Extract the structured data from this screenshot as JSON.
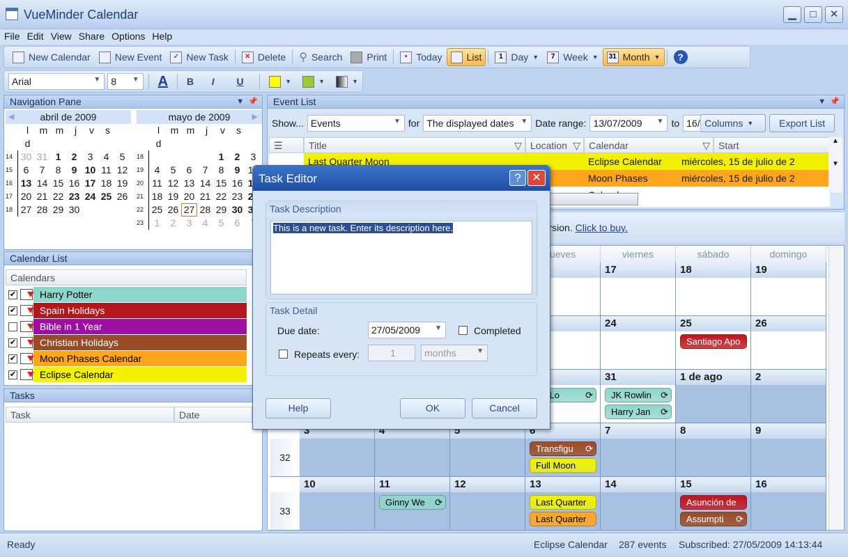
{
  "window": {
    "title": "VueMinder Calendar",
    "min": "▁",
    "max": "□",
    "close": "✕"
  },
  "menu": [
    "File",
    "Edit",
    "View",
    "Share",
    "Options",
    "Help"
  ],
  "toolbar": {
    "new_calendar": "New Calendar",
    "new_event": "New Event",
    "new_task": "New Task",
    "delete": "Delete",
    "search": "Search",
    "print": "Print",
    "today": "Today",
    "list": "List",
    "day": "Day",
    "week": "Week",
    "month": "Month",
    "day_icon": "1",
    "week_icon": "7",
    "month_icon": "31",
    "help": "?"
  },
  "format_bar": {
    "font": "Arial",
    "size": "8",
    "font_color": "A",
    "bold": "B",
    "italic": "I",
    "underline": "U",
    "colors": [
      "#ffff00",
      "#99cc33",
      "#333333"
    ]
  },
  "nav_pane": {
    "title": "Navigation Pane",
    "months": [
      {
        "name": "abril de 2009",
        "weeks": [
          {
            "n": "14",
            "d": [
              "30",
              "31",
              "1",
              "2",
              "3",
              "4",
              "5"
            ],
            "b": [
              2,
              3
            ],
            "g": [
              0,
              1
            ]
          },
          {
            "n": "15",
            "d": [
              "6",
              "7",
              "8",
              "9",
              "10",
              "11",
              "12"
            ],
            "b": [
              3,
              4
            ]
          },
          {
            "n": "16",
            "d": [
              "13",
              "14",
              "15",
              "16",
              "17",
              "18",
              "19"
            ],
            "b": [
              0,
              4
            ]
          },
          {
            "n": "17",
            "d": [
              "20",
              "21",
              "22",
              "23",
              "24",
              "25",
              "26"
            ],
            "b": [
              3,
              4,
              5
            ]
          },
          {
            "n": "18",
            "d": [
              "27",
              "28",
              "29",
              "30",
              "",
              "",
              ""
            ]
          }
        ]
      },
      {
        "name": "mayo de 2009",
        "weeks": [
          {
            "n": "18",
            "d": [
              "",
              "",
              "",
              "",
              "1",
              "2",
              "3"
            ],
            "b": [
              4,
              5
            ]
          },
          {
            "n": "19",
            "d": [
              "4",
              "5",
              "6",
              "7",
              "8",
              "9",
              "10"
            ],
            "b": [
              5
            ]
          },
          {
            "n": "20",
            "d": [
              "11",
              "12",
              "13",
              "14",
              "15",
              "16",
              "17"
            ],
            "b": [
              6
            ]
          },
          {
            "n": "21",
            "d": [
              "18",
              "19",
              "20",
              "21",
              "22",
              "23",
              "24"
            ],
            "b": [
              6
            ]
          },
          {
            "n": "22",
            "d": [
              "25",
              "26",
              "27",
              "28",
              "29",
              "30",
              "31"
            ],
            "b": [
              5,
              6
            ],
            "today": 2
          },
          {
            "n": "23",
            "d": [
              "1",
              "2",
              "3",
              "4",
              "5",
              "6",
              "7"
            ],
            "g": [
              0,
              1,
              2,
              3,
              4,
              5,
              6
            ]
          }
        ]
      }
    ],
    "weekdays": [
      "l",
      "m",
      "m",
      "j",
      "v",
      "s",
      "d"
    ]
  },
  "calendar_list": {
    "title": "Calendar List",
    "column": "Calendars",
    "items": [
      {
        "name": "Harry Potter",
        "checked": true,
        "color": "#8fd6cc",
        "text": "#000"
      },
      {
        "name": "Spain Holidays",
        "checked": true,
        "color": "#b3161b",
        "text": "#fff"
      },
      {
        "name": "Bible in 1 Year",
        "checked": false,
        "color": "#9b0fa3",
        "text": "#fff"
      },
      {
        "name": "Christian Holidays",
        "checked": true,
        "color": "#9a4a24",
        "text": "#fff"
      },
      {
        "name": "Moon Phases Calendar",
        "checked": true,
        "color": "#ffa51e",
        "text": "#000"
      },
      {
        "name": "Eclipse Calendar",
        "checked": true,
        "color": "#f2f200",
        "text": "#000"
      }
    ]
  },
  "tasks": {
    "title": "Tasks",
    "columns": [
      "Task",
      "Date"
    ]
  },
  "event_list": {
    "title": "Event List",
    "show_label": "Show...",
    "show_value": "Events",
    "for_label": "for",
    "for_value": "The displayed dates",
    "range_label": "Date range:",
    "range_from": "13/07/2009",
    "to_label": "to",
    "range_to": "16/",
    "columns_btn": "Columns",
    "export_btn": "Export List",
    "headers": [
      "Title",
      "Location",
      "Calendar",
      "Start"
    ],
    "rows": [
      {
        "title": "Last Quarter Moon",
        "calendar": "Eclipse Calendar",
        "start": "miércoles, 15 de julio de 2",
        "color": "#f0f000"
      },
      {
        "title": "",
        "calendar": "Moon Phases Calendar",
        "start": "miércoles, 15 de julio de 2",
        "color": "#ffa51e"
      }
    ]
  },
  "trial": {
    "text": "This is atrial version.",
    "link": "Click to buy."
  },
  "month_view": {
    "weekdays": [
      "",
      "",
      "",
      "ueves",
      "viernes",
      "sábado",
      "domingo"
    ],
    "weeks": [
      {
        "n": "",
        "days": [
          "",
          "",
          "",
          "",
          "17",
          "18",
          "19"
        ],
        "shade": []
      },
      {
        "n": "",
        "days": [
          "",
          "",
          "",
          "",
          "24",
          "25",
          "26"
        ],
        "shade": []
      },
      {
        "n": "",
        "days": [
          "",
          "",
          "",
          "",
          "31",
          "1 de ago",
          "2"
        ],
        "shade": [
          5,
          6
        ]
      },
      {
        "n": "32",
        "days": [
          "3",
          "4",
          "5",
          "6",
          "7",
          "8",
          "9"
        ],
        "shade": [
          0,
          1,
          2,
          3,
          4,
          5,
          6
        ]
      },
      {
        "n": "33",
        "days": [
          "10",
          "11",
          "12",
          "13",
          "14",
          "15",
          "16"
        ],
        "shade": [
          0,
          1,
          2,
          3,
          4,
          5,
          6
        ]
      }
    ],
    "events": [
      {
        "week": 1,
        "day": 5,
        "slot": 0,
        "title": "Santiago Apo",
        "color": "#c0141c",
        "text": "#fff"
      },
      {
        "week": 2,
        "day": 3,
        "slot": 0,
        "title": "ille Lo",
        "color": "#8fd6cc",
        "text": "#000",
        "recurring": true
      },
      {
        "week": 2,
        "day": 4,
        "slot": 0,
        "title": "JK Rowlin",
        "color": "#8fd6cc",
        "text": "#000",
        "recurring": true
      },
      {
        "week": 2,
        "day": 4,
        "slot": 1,
        "title": "Harry Jan",
        "color": "#8fd6cc",
        "text": "#000",
        "recurring": true
      },
      {
        "week": 3,
        "day": 3,
        "slot": 0,
        "title": "Transfigu",
        "color": "#9a4a24",
        "text": "#fff",
        "recurring": true
      },
      {
        "week": 3,
        "day": 3,
        "slot": 1,
        "title": "Full Moon",
        "color": "#f2f200",
        "text": "#000"
      },
      {
        "week": 4,
        "day": 1,
        "slot": 0,
        "title": "Ginny We",
        "color": "#8fd6cc",
        "text": "#000",
        "recurring": true
      },
      {
        "week": 4,
        "day": 3,
        "slot": 0,
        "title": "Last Quarter",
        "color": "#f2f200",
        "text": "#000"
      },
      {
        "week": 4,
        "day": 3,
        "slot": 1,
        "title": "Last Quarter",
        "color": "#ffa51e",
        "text": "#000"
      },
      {
        "week": 4,
        "day": 5,
        "slot": 0,
        "title": "Asunción de",
        "color": "#c0141c",
        "text": "#fff"
      },
      {
        "week": 4,
        "day": 5,
        "slot": 1,
        "title": "Assumpti",
        "color": "#9a4a24",
        "text": "#fff",
        "recurring": true
      }
    ]
  },
  "dialog": {
    "title": "Task Editor",
    "help_icon": "?",
    "close_icon": "✕",
    "desc_section": "Task Description",
    "desc_text": "This is a new task.  Enter its description here.",
    "detail_section": "Task Detail",
    "due_label": "Due date:",
    "due_value": "27/05/2009",
    "completed_label": "Completed",
    "completed": false,
    "repeats_label": "Repeats every:",
    "repeats": false,
    "repeat_count": "1",
    "repeat_unit": "months",
    "help_btn": "Help",
    "ok_btn": "OK",
    "cancel_btn": "Cancel"
  },
  "status": {
    "left": "Ready",
    "calendar": "Eclipse Calendar",
    "count": "287 events",
    "subscribed": "Subscribed: 27/05/2009 14:13:44"
  }
}
